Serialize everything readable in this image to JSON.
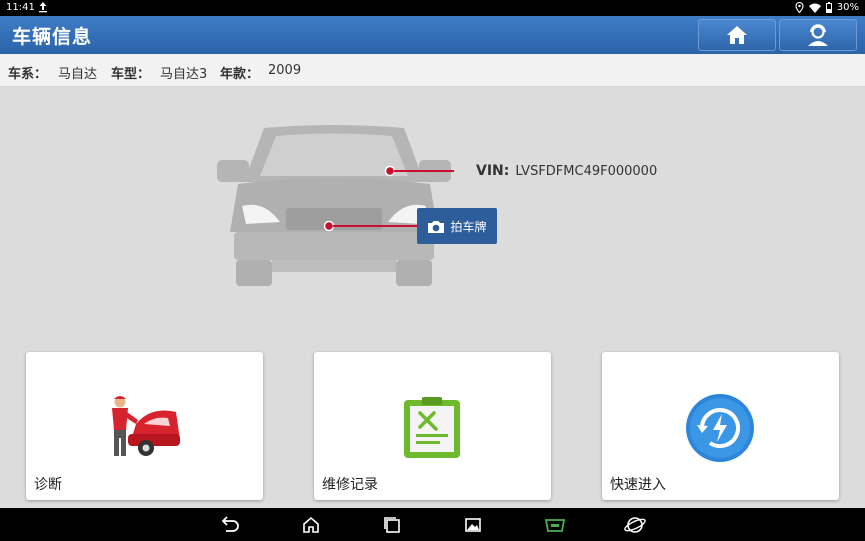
{
  "status": {
    "time": "11:41",
    "battery": "30%"
  },
  "header": {
    "title": "车辆信息"
  },
  "vehicle": {
    "brand_label": "车系：",
    "brand": "马自达",
    "model_label": "车型：",
    "model": "马自达3",
    "year_label": "年款：",
    "year": "2009",
    "vin_label": "VIN:",
    "vin": "LVSFDFMC49F000000",
    "photo_button": "拍车牌"
  },
  "cards": [
    {
      "label": "诊断",
      "icon": "mechanic-car-icon"
    },
    {
      "label": "维修记录",
      "icon": "clipboard-tools-icon"
    },
    {
      "label": "快速进入",
      "icon": "quick-access-icon"
    }
  ],
  "colors": {
    "header": "#2b63a8",
    "photo_button": "#2d5e9b",
    "marker": "#c8102e"
  }
}
